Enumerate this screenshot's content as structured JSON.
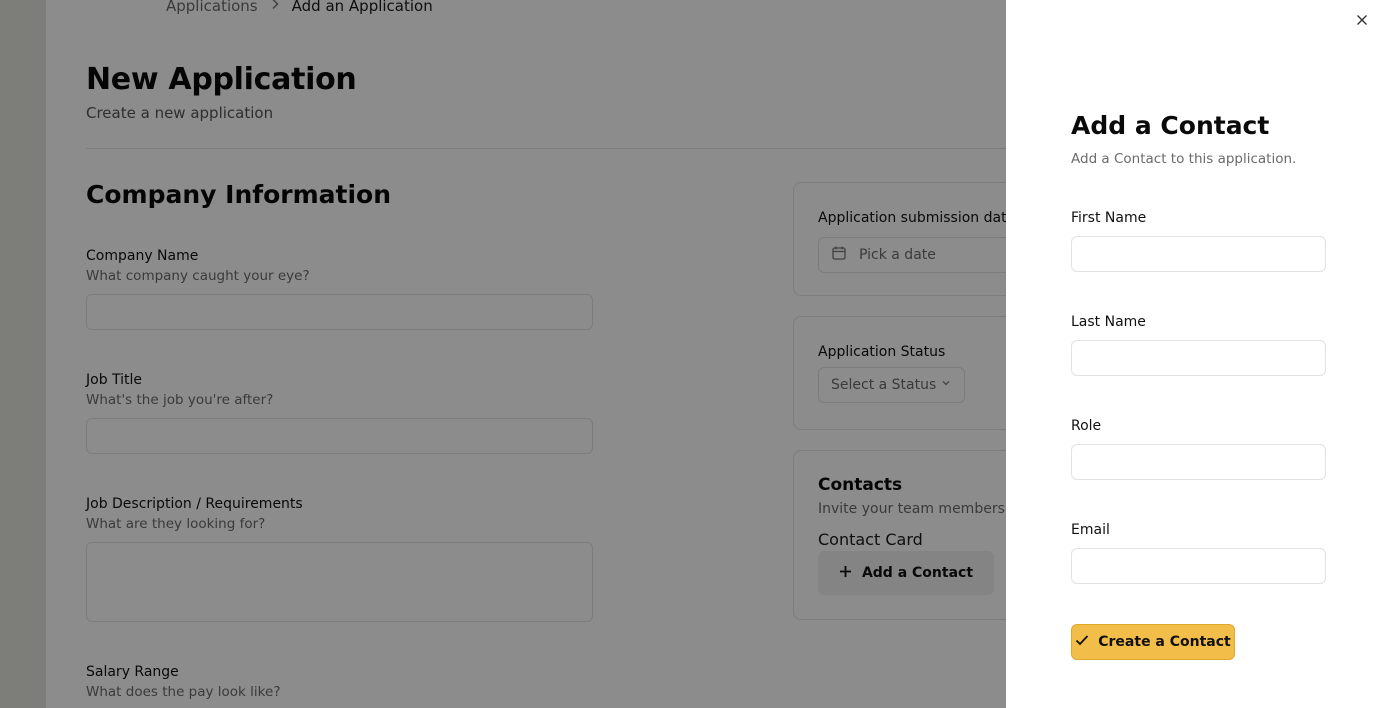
{
  "breadcrumb": {
    "parent": "Applications",
    "current": "Add an Application"
  },
  "page": {
    "title": "New Application",
    "subtitle": "Create a new application"
  },
  "company_section": {
    "title": "Company Information",
    "fields": [
      {
        "label": "Company Name",
        "description": "What company caught your eye?",
        "value": ""
      },
      {
        "label": "Job Title",
        "description": "What's the job you're after?",
        "value": ""
      },
      {
        "label": "Job Description / Requirements",
        "description": "What are they looking for?",
        "value": ""
      },
      {
        "label": "Salary Range",
        "description": "What does the pay look like?"
      }
    ]
  },
  "side_cards": {
    "submission_date": {
      "label": "Application submission date",
      "placeholder": "Pick a date"
    },
    "status": {
      "label": "Application Status",
      "placeholder": "Select a Status"
    },
    "contacts": {
      "title": "Contacts",
      "description": "Invite your team members to",
      "card_label": "Contact Card",
      "add_button": "Add a Contact"
    }
  },
  "drawer": {
    "title": "Add a Contact",
    "description": "Add a Contact to this application.",
    "fields": [
      {
        "label": "First Name",
        "value": ""
      },
      {
        "label": "Last Name",
        "value": ""
      },
      {
        "label": "Role",
        "value": ""
      },
      {
        "label": "Email",
        "value": ""
      }
    ],
    "submit_label": "Create a Contact"
  },
  "colors": {
    "accent": "#f2bd48",
    "overlay": "rgba(0,0,0,0.45)",
    "rail": "#e4e6df"
  },
  "icons": [
    "close-icon",
    "chevron-right-icon",
    "calendar-icon",
    "chevron-down-icon",
    "plus-icon",
    "check-icon"
  ]
}
